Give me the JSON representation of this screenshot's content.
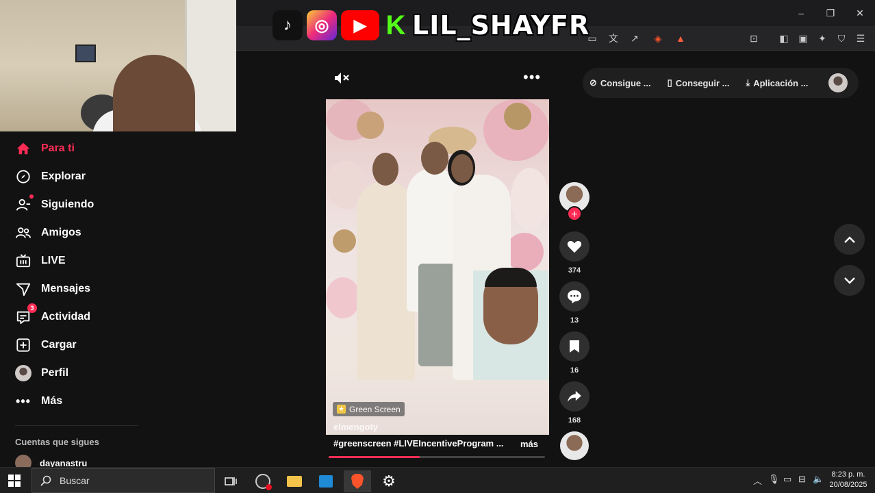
{
  "overlay": {
    "streamer_name": "LIL_SHAYFR",
    "icons": [
      "tiktok-icon",
      "instagram-icon",
      "youtube-icon",
      "kick-icon"
    ]
  },
  "window": {
    "minimize": "–",
    "restore": "❐",
    "close": "✕"
  },
  "sidebar": {
    "items": [
      {
        "label": "Para ti",
        "icon": "home-icon",
        "active": true
      },
      {
        "label": "Explorar",
        "icon": "compass-icon"
      },
      {
        "label": "Siguiendo",
        "icon": "following-icon"
      },
      {
        "label": "Amigos",
        "icon": "friends-icon"
      },
      {
        "label": "LIVE",
        "icon": "live-tv-icon"
      },
      {
        "label": "Mensajes",
        "icon": "paper-plane-icon"
      },
      {
        "label": "Actividad",
        "icon": "activity-icon",
        "badge": "3"
      },
      {
        "label": "Cargar",
        "icon": "upload-plus-icon"
      },
      {
        "label": "Perfil",
        "icon": "profile-avatar-icon"
      },
      {
        "label": "Más",
        "icon": "more-dots-icon"
      }
    ],
    "following_title": "Cuentas que sigues",
    "following_accounts": [
      "dayanastru"
    ]
  },
  "video": {
    "effect_badge": "Green Screen",
    "author": "elmengoty",
    "caption": "#greenscreen  #LIVEIncentiveProgram ...",
    "more_label": "más",
    "progress": 0.42
  },
  "actions": {
    "likes": "374",
    "comments": "13",
    "saves": "16",
    "shares": "168"
  },
  "top_pill": {
    "items": [
      "Consigue ...",
      "Conseguir ...",
      "Aplicación ..."
    ]
  },
  "taskbar": {
    "search_placeholder": "Buscar",
    "time": "8:23 p. m.",
    "date": "20/08/2025"
  },
  "colors": {
    "accent": "#fe2c55",
    "background": "#121212"
  }
}
